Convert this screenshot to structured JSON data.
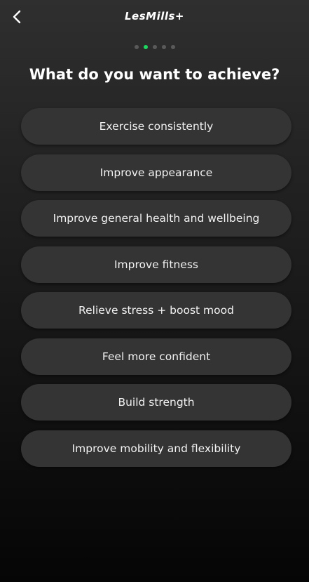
{
  "header": {
    "logo_text": "LesMills+",
    "back_icon": "chevron-left-icon"
  },
  "progress": {
    "total_steps": 5,
    "current_step": 2,
    "active_color": "#1ed760"
  },
  "title": "What do you want to achieve?",
  "options": [
    "Exercise consistently",
    "Improve appearance",
    "Improve general health and wellbeing",
    "Improve fitness",
    "Relieve stress + boost mood",
    "Feel more confident",
    "Build strength",
    "Improve mobility and flexibility"
  ]
}
